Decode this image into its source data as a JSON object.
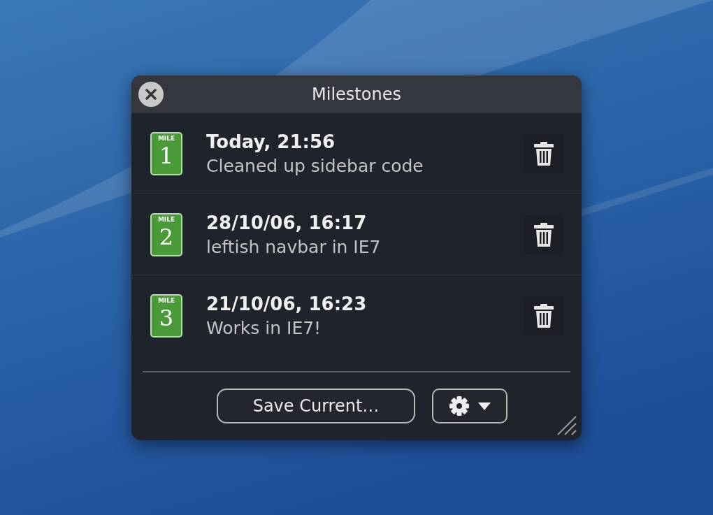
{
  "window": {
    "title": "Milestones"
  },
  "milestones": [
    {
      "badge_label": "MILE",
      "badge_number": "1",
      "date": "Today, 21:56",
      "note": "Cleaned up sidebar code"
    },
    {
      "badge_label": "MILE",
      "badge_number": "2",
      "date": "28/10/06, 16:17",
      "note": "leftish navbar in IE7"
    },
    {
      "badge_label": "MILE",
      "badge_number": "3",
      "date": "21/10/06, 16:23",
      "note": "Works in IE7!"
    }
  ],
  "buttons": {
    "save": "Save Current…"
  }
}
